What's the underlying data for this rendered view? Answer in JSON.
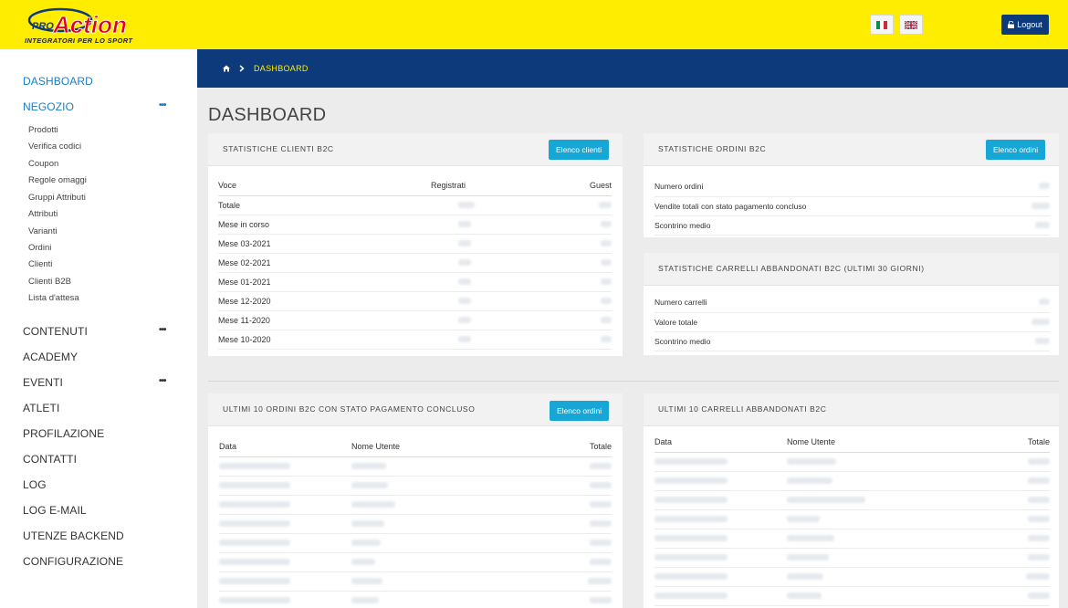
{
  "header": {
    "logo_text": "PRO Action",
    "logo_tagline": "INTEGRATORI PER LO SPORT",
    "logout_label": "Logout",
    "flag_it": "italian-flag-icon",
    "flag_en": "uk-flag-icon"
  },
  "sidebar": {
    "dashboard": "DASHBOARD",
    "negozio": "NEGOZIO",
    "negozio_items": [
      "Prodotti",
      "Verifica codici",
      "Coupon",
      "Regole omaggi",
      "Gruppi Attributi",
      "Attributi",
      "Varianti",
      "Ordini",
      "Clienti",
      "Clienti B2B",
      "Lista d'attesa"
    ],
    "contenuti": "CONTENUTI",
    "academy": "ACADEMY",
    "eventi": "EVENTI",
    "atleti": "ATLETI",
    "profilazione": "PROFILAZIONE",
    "contatti": "CONTATTI",
    "log": "LOG",
    "log_email": "LOG E-MAIL",
    "utenze_backend": "UTENZE BACKEND",
    "configurazione": "CONFIGURAZIONE",
    "more_dots": "•••"
  },
  "breadcrumb": {
    "current": "DASHBOARD"
  },
  "page_title": "DASHBOARD",
  "clienti_panel": {
    "title": "STATISTICHE CLIENTI B2C",
    "button": "Elenco clienti",
    "columns": [
      "Voce",
      "Registrati",
      "Guest"
    ],
    "rows": [
      "Totale",
      "Mese in corso",
      "Mese 03-2021",
      "Mese 02-2021",
      "Mese 01-2021",
      "Mese 12-2020",
      "Mese 11-2020",
      "Mese 10-2020"
    ]
  },
  "ordini_panel": {
    "title": "STATISTICHE ORDINI B2C",
    "button": "Elenco ordini",
    "rows": [
      "Numero ordini",
      "Vendite totali con stato pagamento concluso",
      "Scontrino medio"
    ]
  },
  "carrelli_panel": {
    "title": "STATISTICHE CARRELLI ABBANDONATI B2C (ULTIMI 30 GIORNI)",
    "rows": [
      "Numero carrelli",
      "Valore totale",
      "Scontrino medio"
    ]
  },
  "ultimi_ordini_panel": {
    "title": "ULTIMI 10 ORDINI B2C CON STATO PAGAMENTO CONCLUSO",
    "button": "Elenco ordini",
    "columns": [
      "Data",
      "Nome Utente",
      "Totale"
    ]
  },
  "ultimi_carrelli_panel": {
    "title": "ULTIMI 10 CARRELLI ABBANDONATI B2C",
    "columns": [
      "Data",
      "Nome Utente",
      "Totale"
    ]
  }
}
